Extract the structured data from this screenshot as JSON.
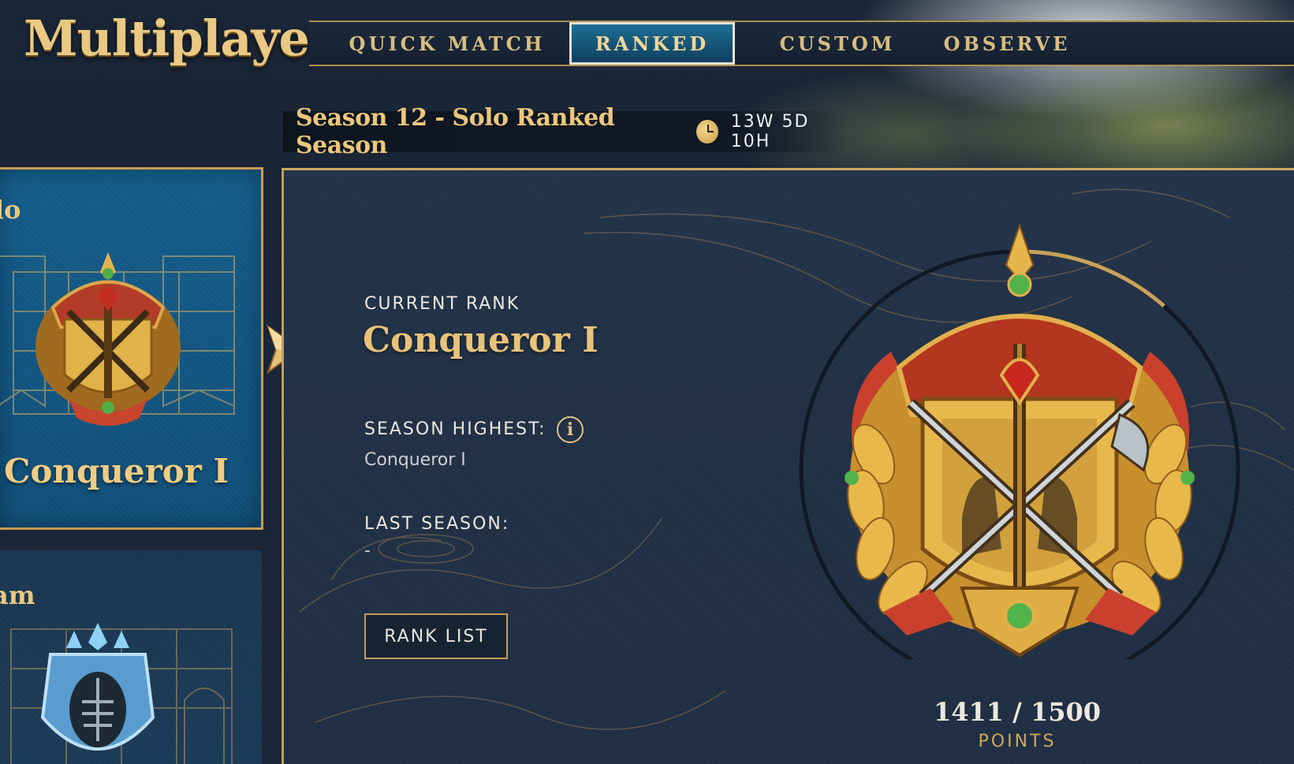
{
  "header": {
    "title": "Multiplayer",
    "tabs": [
      {
        "label": "QUICK MATCH",
        "active": false
      },
      {
        "label": "RANKED",
        "active": true
      },
      {
        "label": "CUSTOM",
        "active": false
      },
      {
        "label": "OBSERVE",
        "active": false
      }
    ]
  },
  "season": {
    "title": "Season 12 - Solo Ranked Season",
    "timer_icon": "clock-icon",
    "timer": "13W 5D 10H"
  },
  "sidebar": {
    "solo": {
      "label": "lo",
      "rank": "Conqueror I",
      "selected": true
    },
    "team": {
      "label": "am"
    }
  },
  "rank": {
    "current_label": "CURRENT RANK",
    "current_value": "Conqueror I",
    "season_highest_label": "SEASON HIGHEST:",
    "season_highest_value": "Conqueror I",
    "last_season_label": "LAST SEASON:",
    "last_season_value": "-",
    "rank_list_button": "RANK LIST"
  },
  "progress": {
    "points_text": "1411 / 1500",
    "points_label": "POINTS",
    "current": 1411,
    "max": 1500
  },
  "colors": {
    "gold": "#e8c37a",
    "active_tab": "#1d6f96",
    "panel": "#223247",
    "emblem_red": "#c7452c"
  }
}
